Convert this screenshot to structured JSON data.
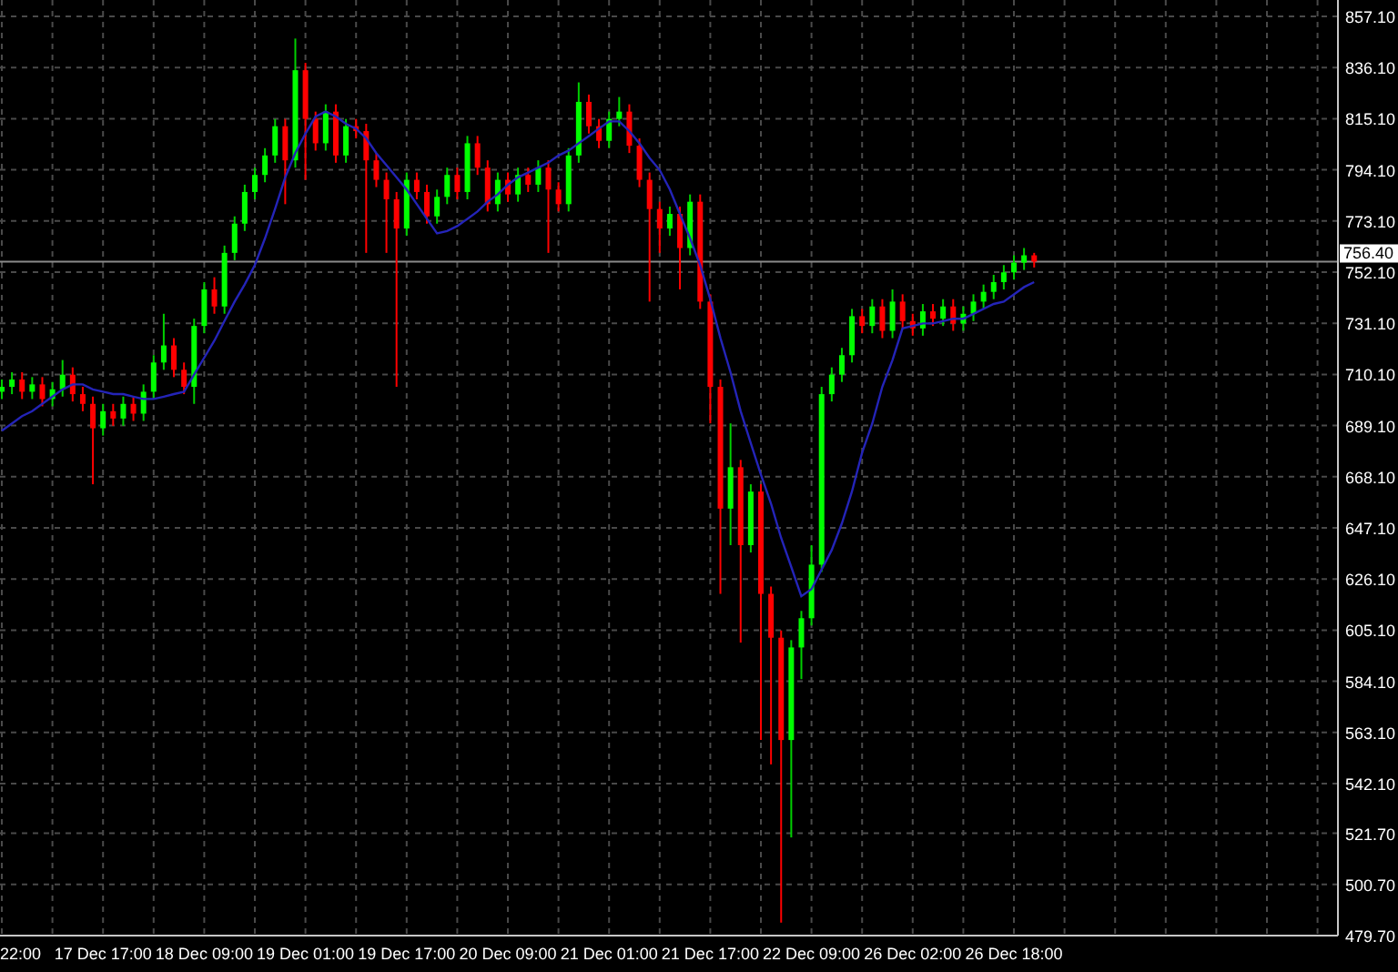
{
  "chart_data": {
    "type": "candlestick",
    "categories": [
      null,
      null,
      null,
      null,
      null,
      null,
      null,
      null,
      null,
      null,
      "17 Dec 17:00",
      null,
      null,
      null,
      null,
      null,
      null,
      null,
      null,
      null,
      "18 Dec 09:00",
      null,
      null,
      null,
      null,
      null,
      null,
      null,
      null,
      null,
      "19 Dec 01:00",
      null,
      null,
      null,
      null,
      null,
      null,
      null,
      null,
      null,
      "19 Dec 17:00",
      null,
      null,
      null,
      null,
      null,
      null,
      null,
      null,
      null,
      "20 Dec 09:00",
      null,
      null,
      null,
      null,
      null,
      null,
      null,
      null,
      null,
      "21 Dec 01:00",
      null,
      null,
      null,
      null,
      null,
      null,
      null,
      null,
      null,
      "21 Dec 17:00",
      null,
      null,
      null,
      null,
      null,
      null,
      null,
      null,
      null,
      "22 Dec 09:00",
      null,
      null,
      null,
      null,
      null,
      null,
      null,
      null,
      null,
      "26 Dec 02:00",
      null,
      null,
      null,
      null,
      null,
      null,
      null,
      null,
      null,
      "26 Dec 18:00",
      null,
      null
    ],
    "grid": true,
    "ref_lines": [
      {
        "axis": "y",
        "value": 756.4,
        "label": "756.40"
      }
    ],
    "ylim": [
      479.7,
      857.1
    ],
    "yticks": [
      {
        "value": 857.1,
        "label": "857.10"
      },
      {
        "value": 836.1,
        "label": "836.10"
      },
      {
        "value": 815.1,
        "label": "815.10"
      },
      {
        "value": 794.1,
        "label": "794.10"
      },
      {
        "value": 773.1,
        "label": "773.10"
      },
      {
        "value": 752.1,
        "label": "752.10"
      },
      {
        "value": 731.1,
        "label": "731.10"
      },
      {
        "value": 710.1,
        "label": "710.10"
      },
      {
        "value": 689.1,
        "label": "689.10"
      },
      {
        "value": 668.1,
        "label": "668.10"
      },
      {
        "value": 647.1,
        "label": "647.10"
      },
      {
        "value": 626.1,
        "label": "626.10"
      },
      {
        "value": 605.1,
        "label": "605.10"
      },
      {
        "value": 584.1,
        "label": "584.10"
      },
      {
        "value": 563.1,
        "label": "563.10"
      },
      {
        "value": 542.1,
        "label": "542.10"
      },
      {
        "value": 521.7,
        "label": "521.70"
      },
      {
        "value": 500.7,
        "label": "500.70"
      },
      {
        "value": 479.7,
        "label": "479.70"
      }
    ],
    "ohlc": [
      [
        703,
        708,
        700,
        705
      ],
      [
        705,
        711,
        702,
        708
      ],
      [
        708,
        711,
        700,
        703
      ],
      [
        703,
        709,
        700,
        706
      ],
      [
        706,
        709,
        697,
        700
      ],
      [
        700,
        707,
        697,
        704
      ],
      [
        704,
        716,
        701,
        710
      ],
      [
        710,
        713,
        699,
        702
      ],
      [
        702,
        705,
        695,
        698
      ],
      [
        698,
        701,
        665,
        688
      ],
      [
        688,
        698,
        685,
        695
      ],
      [
        695,
        698,
        689,
        692
      ],
      [
        692,
        701,
        689,
        698
      ],
      [
        698,
        701,
        691,
        694
      ],
      [
        694,
        706,
        691,
        703
      ],
      [
        703,
        718,
        700,
        715
      ],
      [
        715,
        735,
        712,
        722
      ],
      [
        722,
        725,
        709,
        712
      ],
      [
        712,
        715,
        702,
        705
      ],
      [
        705,
        733,
        698,
        730
      ],
      [
        730,
        748,
        727,
        745
      ],
      [
        745,
        750,
        735,
        738
      ],
      [
        738,
        763,
        735,
        760
      ],
      [
        760,
        775,
        757,
        772
      ],
      [
        772,
        788,
        769,
        785
      ],
      [
        785,
        795,
        782,
        792
      ],
      [
        792,
        803,
        789,
        800
      ],
      [
        800,
        815,
        797,
        812
      ],
      [
        812,
        815,
        780,
        798
      ],
      [
        798,
        848,
        795,
        835
      ],
      [
        835,
        838,
        790,
        815
      ],
      [
        815,
        818,
        802,
        805
      ],
      [
        805,
        821,
        802,
        818
      ],
      [
        818,
        821,
        797,
        800
      ],
      [
        800,
        815,
        797,
        812
      ],
      [
        812,
        815,
        807,
        810
      ],
      [
        810,
        813,
        760,
        798
      ],
      [
        798,
        801,
        787,
        790
      ],
      [
        790,
        793,
        760,
        782
      ],
      [
        782,
        785,
        705,
        770
      ],
      [
        770,
        793,
        767,
        790
      ],
      [
        790,
        793,
        782,
        785
      ],
      [
        785,
        788,
        772,
        775
      ],
      [
        775,
        786,
        772,
        783
      ],
      [
        783,
        795,
        780,
        792
      ],
      [
        792,
        795,
        782,
        785
      ],
      [
        785,
        808,
        782,
        805
      ],
      [
        805,
        808,
        792,
        795
      ],
      [
        795,
        798,
        777,
        780
      ],
      [
        780,
        793,
        777,
        790
      ],
      [
        790,
        793,
        781,
        784
      ],
      [
        784,
        795,
        781,
        792
      ],
      [
        792,
        795,
        785,
        788
      ],
      [
        788,
        798,
        785,
        795
      ],
      [
        795,
        798,
        760,
        786
      ],
      [
        786,
        789,
        777,
        780
      ],
      [
        780,
        803,
        777,
        800
      ],
      [
        800,
        830,
        797,
        822
      ],
      [
        822,
        825,
        809,
        812
      ],
      [
        812,
        815,
        803,
        806
      ],
      [
        806,
        818,
        803,
        815
      ],
      [
        815,
        824,
        812,
        818
      ],
      [
        818,
        821,
        801,
        804
      ],
      [
        804,
        807,
        787,
        790
      ],
      [
        790,
        793,
        740,
        778
      ],
      [
        778,
        781,
        760,
        770
      ],
      [
        770,
        779,
        767,
        776
      ],
      [
        776,
        779,
        745,
        762
      ],
      [
        762,
        784,
        759,
        781
      ],
      [
        781,
        784,
        737,
        740
      ],
      [
        740,
        743,
        690,
        705
      ],
      [
        705,
        708,
        620,
        655
      ],
      [
        655,
        690,
        640,
        672
      ],
      [
        672,
        675,
        600,
        640
      ],
      [
        640,
        665,
        637,
        662
      ],
      [
        662,
        665,
        560,
        620
      ],
      [
        620,
        623,
        550,
        602
      ],
      [
        602,
        605,
        485,
        560
      ],
      [
        560,
        601,
        520,
        598
      ],
      [
        598,
        613,
        585,
        610
      ],
      [
        610,
        640,
        607,
        632
      ],
      [
        632,
        705,
        629,
        702
      ],
      [
        702,
        713,
        699,
        710
      ],
      [
        710,
        721,
        707,
        718
      ],
      [
        718,
        737,
        715,
        734
      ],
      [
        734,
        737,
        727,
        730
      ],
      [
        730,
        741,
        727,
        738
      ],
      [
        738,
        741,
        725,
        728
      ],
      [
        728,
        745,
        725,
        740
      ],
      [
        740,
        743,
        729,
        732
      ],
      [
        732,
        735,
        726,
        729
      ],
      [
        729,
        739,
        726,
        736
      ],
      [
        736,
        739,
        730,
        733
      ],
      [
        733,
        741,
        730,
        738
      ],
      [
        738,
        741,
        728,
        731
      ],
      [
        731,
        738,
        728,
        735
      ],
      [
        735,
        743,
        732,
        740
      ],
      [
        740,
        747,
        737,
        744
      ],
      [
        744,
        751,
        741,
        748
      ],
      [
        748,
        755,
        745,
        752
      ],
      [
        752,
        759,
        749,
        756
      ],
      [
        756,
        762,
        753,
        759
      ],
      [
        759,
        760,
        754,
        756.4
      ]
    ],
    "series": [
      {
        "type": "line",
        "color": "#2424b8",
        "values": [
          687,
          690,
          693,
          695,
          698,
          701,
          704,
          706,
          706,
          704,
          703,
          702,
          702,
          701,
          700,
          700,
          701,
          702,
          703,
          710,
          717,
          724,
          732,
          740,
          747,
          755,
          766,
          778,
          791,
          801,
          809,
          816,
          818,
          816,
          813,
          811,
          807,
          801,
          796,
          791,
          786,
          780,
          774,
          768,
          769,
          771,
          774,
          777,
          781,
          784,
          788,
          791,
          793,
          795,
          797,
          800,
          802,
          805,
          808,
          811,
          814,
          814,
          810,
          805,
          799,
          794,
          786,
          776,
          766,
          755,
          741,
          725,
          711,
          695,
          682,
          669,
          657,
          643,
          631,
          619,
          622,
          630,
          638,
          649,
          662,
          678,
          690,
          705,
          716,
          729,
          730,
          731,
          731,
          732,
          733,
          733,
          735,
          737,
          739,
          740,
          743,
          746,
          748
        ]
      }
    ]
  },
  "time_axis_cut_label": "22:00"
}
